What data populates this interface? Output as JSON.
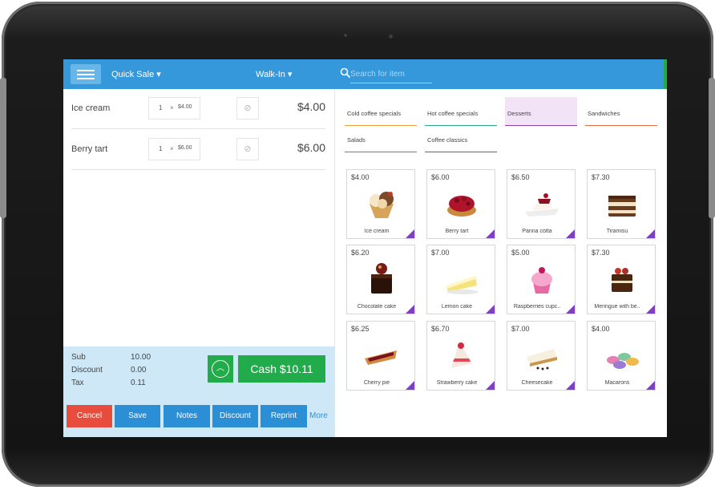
{
  "topbar": {
    "sale_type": "Quick Sale ▾",
    "customer": "Walk-In ▾",
    "search_placeholder": "Search for item"
  },
  "order": {
    "lines": [
      {
        "name": "Ice cream",
        "qty": "1",
        "x": "×",
        "unit_price": "$4.00",
        "total": "$4.00"
      },
      {
        "name": "Berry tart",
        "qty": "1",
        "x": "×",
        "unit_price": "$6.00",
        "total": "$6.00"
      }
    ]
  },
  "summary": {
    "sub_label": "Sub",
    "sub_value": "10.00",
    "discount_label": "Discount",
    "discount_value": "0.00",
    "tax_label": "Tax",
    "tax_value": "0.11",
    "cash_label": "Cash  $10.11"
  },
  "actions": {
    "cancel": "Cancel",
    "save": "Save",
    "notes": "Notes",
    "discount": "Discount",
    "reprint": "Reprint",
    "more": "More"
  },
  "categories": [
    {
      "label": "Cold coffee specials",
      "color": "#e8a040"
    },
    {
      "label": "Hot coffee specials",
      "color": "#2ca58d"
    },
    {
      "label": "Desserts",
      "color": "#8e44ad"
    },
    {
      "label": "Sandwiches",
      "color": "#e0704a"
    },
    {
      "label": "Salads",
      "color": "#2a9bb0"
    },
    {
      "label": "Coffee classics",
      "color": "#8e44ad"
    }
  ],
  "products": [
    {
      "price": "$4.00",
      "name": "Ice cream"
    },
    {
      "price": "$6.00",
      "name": "Berry tart"
    },
    {
      "price": "$6.50",
      "name": "Panna cotta"
    },
    {
      "price": "$7.30",
      "name": "Tiramisu"
    },
    {
      "price": "$6.20",
      "name": "Chocolate cake"
    },
    {
      "price": "$7.00",
      "name": "Lemon cake"
    },
    {
      "price": "$5.00",
      "name": "Raspberries cupc.."
    },
    {
      "price": "$7.30",
      "name": "Meringue with be.."
    },
    {
      "price": "$6.25",
      "name": "Cherry pie"
    },
    {
      "price": "$6.70",
      "name": "Strawberry cake"
    },
    {
      "price": "$7.00",
      "name": "Cheesecake"
    },
    {
      "price": "$4.00",
      "name": "Macarons"
    }
  ],
  "colors": {
    "accent": "#3498db",
    "cash": "#22ab4b",
    "cancel": "#e74c3c",
    "corner": "#7e3fc2"
  }
}
